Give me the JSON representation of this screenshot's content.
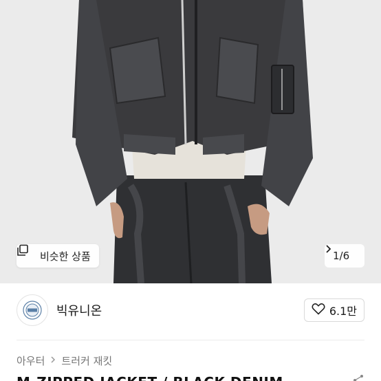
{
  "hero": {
    "similar_label": "비슷한 상품",
    "counter": "1/6"
  },
  "seller": {
    "name": "빅유니온",
    "likes": "6.1만"
  },
  "breadcrumb": {
    "category": "아우터",
    "subcategory": "트러커 재킷"
  },
  "product": {
    "title": "M-ZIPPED JACKET / BLACK DENIM"
  },
  "colors": {
    "denim": "#3a3a3d",
    "background": "#e9e9e9",
    "text": "#1a1a1a"
  }
}
